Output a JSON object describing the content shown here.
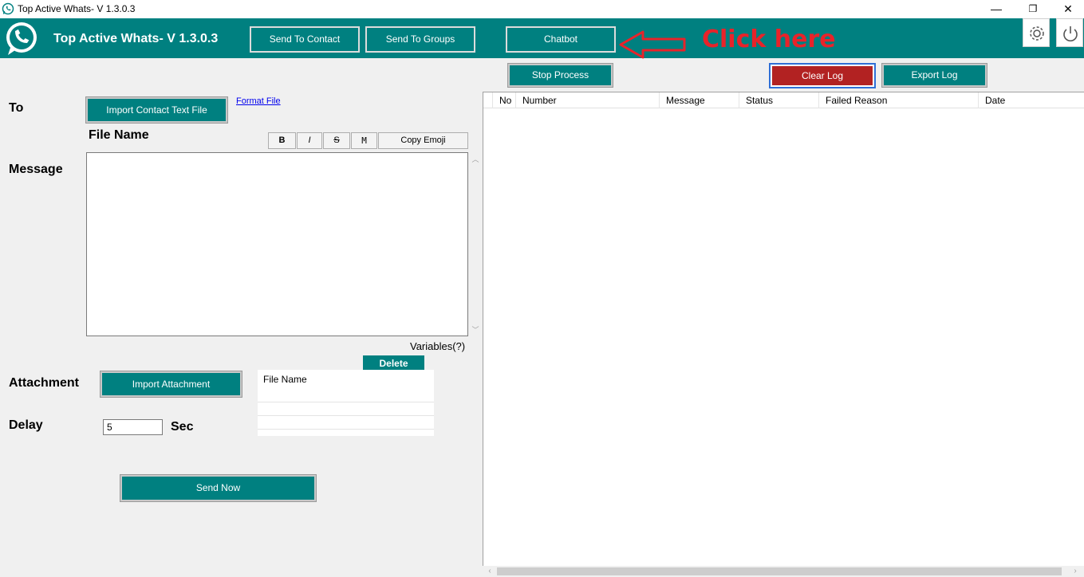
{
  "window": {
    "title": "Top Active Whats- V 1.3.0.3",
    "controls": {
      "minimize": "—",
      "restore": "❐",
      "close": "✕"
    }
  },
  "header": {
    "app_title": "Top Active Whats- V 1.3.0.3",
    "tabs": [
      "Send To Contact",
      "Send To Groups",
      "Chatbot"
    ],
    "annotation": "Click here",
    "icons": [
      "gear-icon",
      "power-icon"
    ]
  },
  "toolbar": {
    "stop_process": "Stop Process",
    "clear_log": "Clear Log",
    "export_log": "Export Log"
  },
  "form": {
    "to_label": "To",
    "import_contact_button": "Import Contact Text File",
    "format_file_link": "Format File",
    "file_name_label": "File Name",
    "format_buttons": [
      "B",
      "I",
      "S",
      "M"
    ],
    "copy_emoji_button": "Copy Emoji",
    "message_label": "Message",
    "message_value": "",
    "variables_label": "Variables(?)",
    "delete_button": "Delete",
    "attachment_label": "Attachment",
    "import_attachment_button": "Import Attachment",
    "attachment_list_header": "File Name",
    "delay_label": "Delay",
    "delay_value": "5",
    "delay_unit": "Sec",
    "send_button": "Send Now"
  },
  "log_table": {
    "columns": [
      "No",
      "Number",
      "Message",
      "Status",
      "Failed Reason",
      "Date"
    ],
    "rows": []
  },
  "colors": {
    "accent": "#008080",
    "clear_log": "#b22222",
    "annotation": "#e8232a"
  }
}
